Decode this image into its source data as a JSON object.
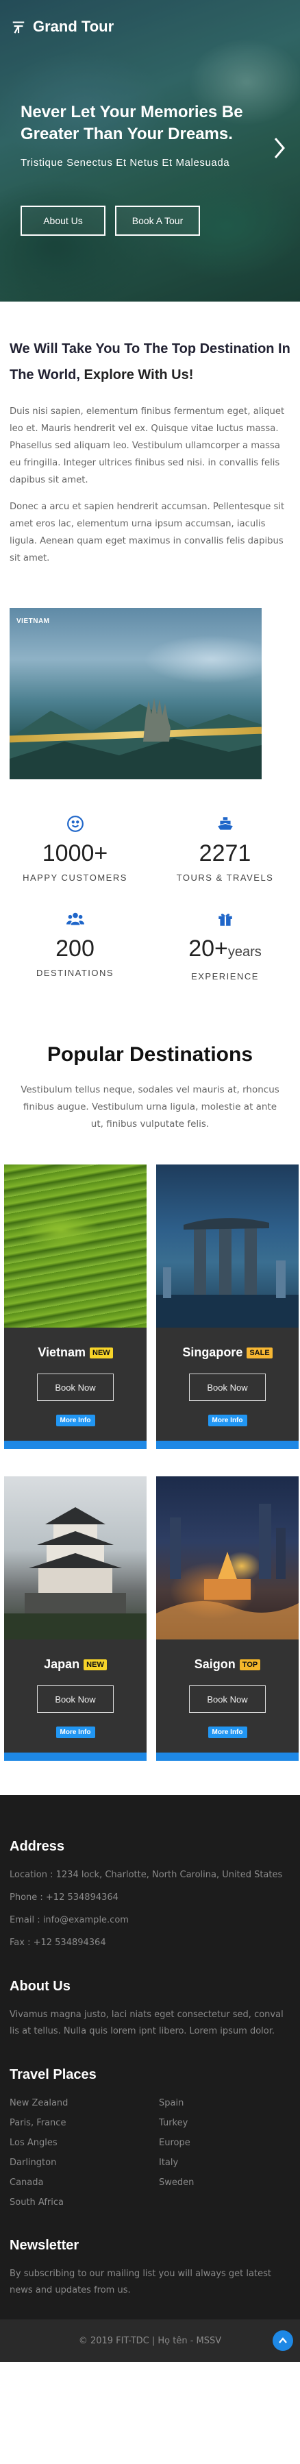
{
  "brand": "Grand Tour",
  "hero": {
    "title": "Never Let Your Memories Be Greater Than Your Dreams.",
    "subtitle": "Tristique Senectus Et Netus Et Malesuada",
    "btn_about": "About Us",
    "btn_book": "Book A Tour"
  },
  "intro": {
    "heading_plain": "We Will Take You To The Top Destination In The World, ",
    "heading_bold": "Explore With Us!",
    "p1": "Duis nisi sapien, elementum finibus fermentum eget, aliquet leo et. Mauris hendrerit vel ex. Quisque vitae luctus massa. Phasellus sed aliquam leo. Vestibulum ullamcorper a massa eu fringilla. Integer ultrices finibus sed nisi. in convallis felis dapibus sit amet.",
    "p2": "Donec a arcu et sapien hendrerit accumsan. Pellentesque sit amet eros lac, elementum urna ipsum accumsan, iaculis ligula. Aenean quam eget maximus in convallis felis dapibus sit amet.",
    "image_label": "VIETNAM"
  },
  "stats": [
    {
      "icon": "smile-icon",
      "number": "1000+",
      "suffix": "",
      "label": "HAPPY CUSTOMERS"
    },
    {
      "icon": "ship-icon",
      "number": "2271",
      "suffix": "",
      "label": "TOURS & TRAVELS"
    },
    {
      "icon": "users-icon",
      "number": "200",
      "suffix": "",
      "label": "DESTINATIONS"
    },
    {
      "icon": "gift-icon",
      "number": "20+",
      "suffix": "years",
      "label": "EXPERIENCE"
    }
  ],
  "popular": {
    "title": "Popular Destinations",
    "subtitle": "Vestibulum tellus neque, sodales vel mauris at, rhoncus finibus augue. Vestibulum urna ligula, molestie at ante ut, finibus vulputate felis."
  },
  "destinations": [
    {
      "name": "Vietnam",
      "badge": "NEW",
      "book": "Book Now",
      "more": "More Info"
    },
    {
      "name": "Singapore",
      "badge": "SALE",
      "book": "Book Now",
      "more": "More Info"
    },
    {
      "name": "Japan",
      "badge": "NEW",
      "book": "Book Now",
      "more": "More Info"
    },
    {
      "name": "Saigon",
      "badge": "TOP",
      "book": "Book Now",
      "more": "More Info"
    }
  ],
  "footer": {
    "address_title": "Address",
    "location": "Location : 1234 lock, Charlotte, North Carolina, United States",
    "phone": "Phone : +12 534894364",
    "email": "Email : info@example.com",
    "fax": "Fax : +12 534894364",
    "about_title": "About Us",
    "about_text": "Vivamus magna justo, laci niats eget consectetur sed, conval lis at tellus. Nulla quis lorem ipnt libero. Lorem ipsum dolor.",
    "places_title": "Travel Places",
    "places": [
      "New Zealand",
      "Spain",
      "Paris, France",
      "Turkey",
      "Los Angles",
      "Europe",
      "Darlington",
      "Italy",
      "Canada",
      "Sweden",
      "South Africa"
    ],
    "newsletter_title": "Newsletter",
    "newsletter_text": "By subscribing to our mailing list you will always get latest news and updates from us.",
    "copyright": "© 2019 FIT-TDC | Họ tên - MSSV"
  },
  "colors": {
    "accent": "#1e88e5",
    "icon_blue": "#1f66c9",
    "card_bg": "#333333",
    "footer_bg": "#1c1c1c"
  }
}
